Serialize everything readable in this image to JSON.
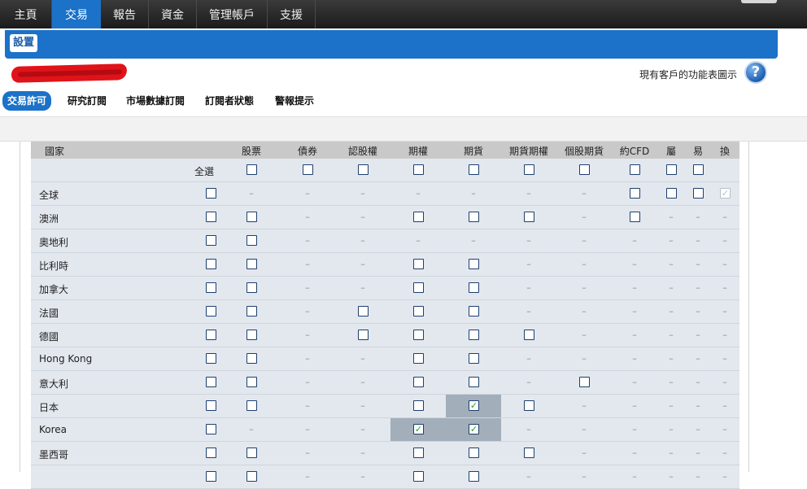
{
  "nav": {
    "tabs": [
      "主頁",
      "交易",
      "報告",
      "資金",
      "管理帳戶",
      "支援"
    ],
    "active_index": 1
  },
  "header": {
    "title": "設置"
  },
  "menu_link": "現有客戶的功能表圖示",
  "help_icon": "question-mark-icon",
  "subtabs": [
    "交易許可",
    "研究訂閱",
    "市場數據訂閱",
    "訂閱者狀態",
    "警報提示"
  ],
  "table": {
    "columns": [
      "國家",
      "股票",
      "債券",
      "認股權",
      "期權",
      "期貨",
      "期貨期權",
      "個股期貨",
      "約CFD",
      "屬",
      "易",
      "換"
    ],
    "select_all_label": "全選",
    "select_all": [
      "cb",
      "cb",
      "cb",
      "cb",
      "cb",
      "cb",
      "cb",
      "cb",
      "cb",
      "cb",
      "cb",
      ""
    ],
    "rows": [
      {
        "label": "全球",
        "cells": [
          "cb",
          "-",
          "-",
          "-",
          "-",
          "-",
          "-",
          "-",
          "cb",
          "cb",
          "cb",
          "cbx"
        ]
      },
      {
        "label": "澳洲",
        "cells": [
          "cb",
          "cb",
          "-",
          "-",
          "cb",
          "cb",
          "cb",
          "-",
          "cb",
          "-",
          "-",
          "-"
        ]
      },
      {
        "label": "奧地利",
        "cells": [
          "cb",
          "cb",
          "-",
          "-",
          "-",
          "-",
          "-",
          "-",
          "-",
          "-",
          "-",
          "-"
        ]
      },
      {
        "label": "比利時",
        "cells": [
          "cb",
          "cb",
          "-",
          "-",
          "cb",
          "cb",
          "-",
          "-",
          "-",
          "-",
          "-",
          "-"
        ]
      },
      {
        "label": "加拿大",
        "cells": [
          "cb",
          "cb",
          "-",
          "-",
          "cb",
          "cb",
          "-",
          "-",
          "-",
          "-",
          "-",
          "-"
        ]
      },
      {
        "label": "法國",
        "cells": [
          "cb",
          "cb",
          "-",
          "cb",
          "cb",
          "cb",
          "-",
          "-",
          "-",
          "-",
          "-",
          "-"
        ]
      },
      {
        "label": "德國",
        "cells": [
          "cb",
          "cb",
          "-",
          "cb",
          "cb",
          "cb",
          "cb",
          "-",
          "-",
          "-",
          "-",
          "-"
        ]
      },
      {
        "label": "Hong Kong",
        "cells": [
          "cb",
          "cb",
          "-",
          "-",
          "cb",
          "cb",
          "-",
          "-",
          "-",
          "-",
          "-",
          "-"
        ]
      },
      {
        "label": "意大利",
        "cells": [
          "cb",
          "cb",
          "-",
          "-",
          "cb",
          "cb",
          "-",
          "cb",
          "-",
          "-",
          "-",
          "-"
        ]
      },
      {
        "label": "日本",
        "cells": [
          "cb",
          "cb",
          "-",
          "-",
          "cb",
          "cbh",
          "cb",
          "-",
          "-",
          "-",
          "-",
          "-"
        ]
      },
      {
        "label": "Korea",
        "cells": [
          "cb",
          "-",
          "-",
          "-",
          "cbh",
          "cbh",
          "-",
          "-",
          "-",
          "-",
          "-",
          "-"
        ]
      },
      {
        "label": "墨西哥",
        "cells": [
          "cb",
          "cb",
          "-",
          "-",
          "cb",
          "cb",
          "cb",
          "-",
          "-",
          "-",
          "-",
          "-"
        ]
      },
      {
        "label": "",
        "cells": [
          "cb",
          "cb",
          "-",
          "-",
          "cb",
          "cb",
          "-",
          "-",
          "-",
          "-",
          "-",
          "-"
        ]
      }
    ]
  },
  "colors": {
    "accent": "#1b72c8",
    "nav_bg": "#262626",
    "row_bg": "#e3e8ee",
    "highlight": "#a2aeb9"
  }
}
